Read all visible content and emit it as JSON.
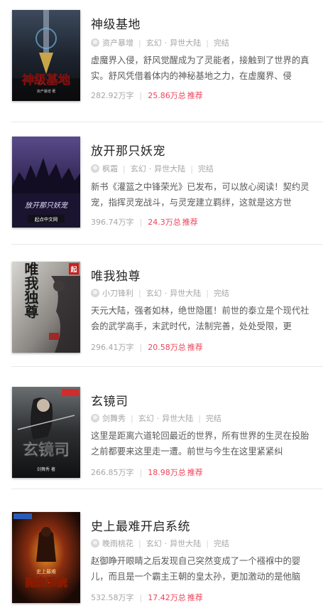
{
  "books": [
    {
      "title": "神级基地",
      "author": "资产暴增",
      "category": "玄幻",
      "subcategory": "异世大陆",
      "status": "完结",
      "description": "虚魔界入侵，舒风觉醒成为了灵能者，接触到了世界的真实。舒风凭借着体内的神秘基地之力，在虚魔界、侵",
      "word_count": "282.92万字",
      "recommend_count": "25.86万总",
      "recommend_label": "推荐",
      "cover_text": "神级基地",
      "cover_subtext": "资产暴增 著"
    },
    {
      "title": "放开那只妖宠",
      "author": "枫霜",
      "category": "玄幻",
      "subcategory": "异世大陆",
      "status": "完结",
      "description": "新书《灌篮之中锋荣光》已发布，可以放心阅读！契约灵宠，指挥灵宠战斗，与灵宠建立羁绊，这就是这方世",
      "word_count": "396.74万字",
      "recommend_count": "24.3万总",
      "recommend_label": "推荐",
      "cover_text": "放开那只妖宠",
      "cover_subtext": "起点中文网"
    },
    {
      "title": "唯我独尊",
      "author": "小刀锋利",
      "category": "玄幻",
      "subcategory": "异世大陆",
      "status": "完结",
      "description": "天元大陆，强者如林，绝世隐匿！前世的泰立是个现代社会的武学高手，末武时代，法制完善，处处受限，更",
      "word_count": "296.41万字",
      "recommend_count": "20.58万总",
      "recommend_label": "推荐",
      "cover_text": "唯我独尊",
      "cover_subtext": "起"
    },
    {
      "title": "玄镜司",
      "author": "剑舞秀",
      "category": "玄幻",
      "subcategory": "异世大陆",
      "status": "完结",
      "description": "这里是距离六道轮回最近的世界，所有世界的生灵在投胎之前都要来这里走一遭。前世与今生在这里紧紧纠",
      "word_count": "266.85万字",
      "recommend_count": "18.98万总",
      "recommend_label": "推荐",
      "cover_text": "玄镜司",
      "cover_subtext": "剑舞秀 著"
    },
    {
      "title": "史上最难开启系统",
      "author": "晚雨桃花",
      "category": "玄幻",
      "subcategory": "异世大陆",
      "status": "完结",
      "description": "赵御睁开眼睛之后发现自己突然变成了一个襁褓中的婴儿，而且是一个霸主王朝的皇太孙，更加激动的是他脑",
      "word_count": "532.58万字",
      "recommend_count": "17.42万总",
      "recommend_label": "推荐",
      "cover_text": "開启系統",
      "cover_subtext": "史上最难"
    }
  ]
}
